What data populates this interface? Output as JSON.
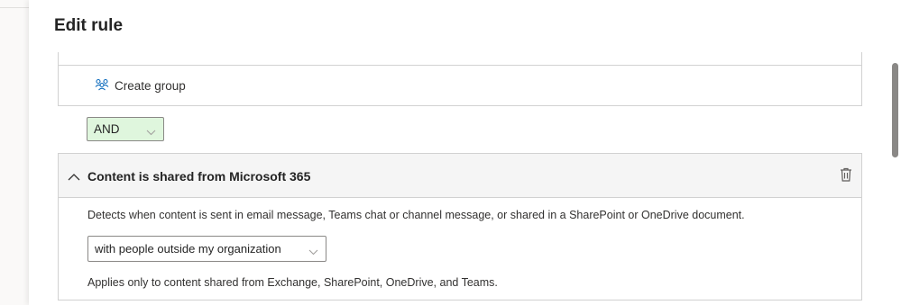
{
  "panel": {
    "title": "Edit rule"
  },
  "group": {
    "create_group_label": "Create group"
  },
  "operator": {
    "selected": "AND"
  },
  "condition": {
    "title": "Content is shared from Microsoft 365",
    "description": "Detects when content is sent in email message, Teams chat or channel message, or shared in a SharePoint or OneDrive document.",
    "scope_selected": "with people outside my organization",
    "note": "Applies only to content shared from Exchange, SharePoint, OneDrive, and Teams."
  },
  "icons": {
    "create_group": "people-group-icon",
    "collapse": "chevron-up-icon",
    "delete": "trash-icon",
    "dropdown": "chevron-down-icon"
  },
  "colors": {
    "and_background": "#dff6dd",
    "icon_accent": "#0f6cbd"
  }
}
